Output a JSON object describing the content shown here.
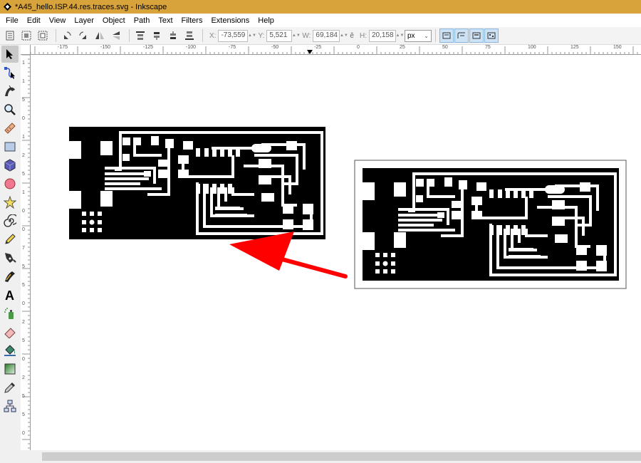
{
  "window": {
    "title": "*A45_hello.ISP.44.res.traces.svg - Inkscape"
  },
  "menu": [
    {
      "label": "File"
    },
    {
      "label": "Edit"
    },
    {
      "label": "View"
    },
    {
      "label": "Layer"
    },
    {
      "label": "Object"
    },
    {
      "label": "Path"
    },
    {
      "label": "Text"
    },
    {
      "label": "Filters"
    },
    {
      "label": "Extensions"
    },
    {
      "label": "Help"
    }
  ],
  "toolbar": {
    "x_label": "X:",
    "x_value": "-73,559",
    "y_label": "Y:",
    "y_value": "5,521",
    "w_label": "W:",
    "w_value": "69,184",
    "h_label": "H:",
    "h_value": "20,158",
    "unit": "px"
  },
  "ruler": {
    "h_labels": [
      "-175",
      "-150",
      "-125",
      "-100",
      "-75",
      "-50",
      "-25",
      "0",
      "25",
      "50",
      "75",
      "100",
      "125",
      "150"
    ],
    "v_labels": [
      "1",
      "1",
      "5",
      "0",
      "1",
      "2",
      "5",
      "1",
      "0",
      "0",
      "7",
      "5",
      "5",
      "0",
      "2",
      "5",
      "0",
      "2",
      "5",
      "5",
      "0"
    ]
  },
  "tools": [
    {
      "name": "selector-tool-icon"
    },
    {
      "name": "node-tool-icon"
    },
    {
      "name": "tweak-tool-icon"
    },
    {
      "name": "zoom-tool-icon"
    },
    {
      "name": "measure-tool-icon"
    },
    {
      "name": "rectangle-tool-icon"
    },
    {
      "name": "3d-box-tool-icon"
    },
    {
      "name": "ellipse-tool-icon"
    },
    {
      "name": "star-tool-icon"
    },
    {
      "name": "spiral-tool-icon"
    },
    {
      "name": "pencil-tool-icon"
    },
    {
      "name": "pen-tool-icon"
    },
    {
      "name": "calligraphy-tool-icon"
    },
    {
      "name": "text-tool-icon"
    },
    {
      "name": "spray-tool-icon"
    },
    {
      "name": "eraser-tool-icon"
    },
    {
      "name": "paint-bucket-tool-icon"
    },
    {
      "name": "gradient-tool-icon"
    },
    {
      "name": "dropper-tool-icon"
    },
    {
      "name": "connector-tool-icon"
    }
  ],
  "colors": {
    "titlebar": "#d8a33a",
    "arrow": "#ff0000",
    "trace": "#000000",
    "selection_active": "#c9c9c9"
  }
}
